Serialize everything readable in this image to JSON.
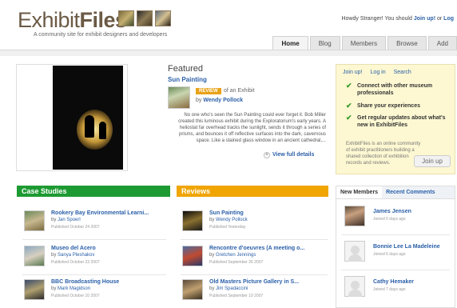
{
  "header": {
    "logo_prefix": "Exhibit",
    "logo_suffix": "Files",
    "tagline": "A community site for exhibit designers and developers",
    "howdy_text": "Howdy Stranger!  You should",
    "howdy_join": "Join up!",
    "howdy_or": "or",
    "howdy_login": "Log"
  },
  "nav": {
    "tabs": [
      "Home",
      "Blog",
      "Members",
      "Browse",
      "Add"
    ],
    "active": "Home"
  },
  "featured": {
    "heading": "Featured",
    "title": "Sun Painting",
    "badge": "REVIEW",
    "badge_suffix": "of an Exhibit",
    "by_label": "by",
    "author": "Wendy Pollock",
    "description": "No one who's seen the Sun Painting could ever forget it. Bob Miller created this luminous exhibit during the Exploratorium's early years. A heliostat far overhead tracks the sunlight, sends it through a series of prisms, and bounces it off reflective surfaces into the dark, cavernous space. Like a stained glass window in an ancient cathedral,...",
    "view_full": "View full details"
  },
  "joinbox": {
    "links": [
      "Join up!",
      "Log in",
      "Search"
    ],
    "items": [
      "Connect with other museum professionals",
      "Share your experiences",
      "Get regular updates about what's new in ExhibitFiles"
    ],
    "description": "ExhibitFiles is an online community of exhibit practitioners building a shared collection of exhibition records and reviews.",
    "button": "Join up"
  },
  "case_studies": {
    "heading": "Case Studies",
    "items": [
      {
        "title": "Rookery Bay Environmental Learni...",
        "by": "by",
        "author": "Jan Spoerl",
        "date": "Published October 24 2007"
      },
      {
        "title": "Museo del Acero",
        "by": "by",
        "author": "Sanya Pleshakov",
        "date": "Published October 23 2007"
      },
      {
        "title": "BBC Broadcasting House",
        "by": "by",
        "author": "Mark Magidson",
        "date": "Published October 10 2007"
      }
    ]
  },
  "reviews": {
    "heading": "Reviews",
    "items": [
      {
        "title": "Sun Painting",
        "by": "by",
        "author": "Wendy Pollock",
        "date": "Published Yesterday"
      },
      {
        "title": "Rencontre d'oeuvres (A meeting o...",
        "by": "by",
        "author": "Gretchen Jennings",
        "date": "Published September 26 2007"
      },
      {
        "title": "Old Masters Picture Gallery in S...",
        "by": "by",
        "author": "Jim Spadaccini",
        "date": "Published September 19 2007"
      }
    ]
  },
  "members_panel": {
    "tabs": [
      "New Members",
      "Recent Comments"
    ],
    "members": [
      {
        "name": "James Jensen",
        "joined": "Joined 5 days ago"
      },
      {
        "name": "Bonnie Lee La Madeleine",
        "joined": "Joined 6 days ago"
      },
      {
        "name": "Cathy Hemaker",
        "joined": "Joined 7 days ago"
      }
    ]
  },
  "colors": {
    "link": "#2a5fa8",
    "case_studies_green": "#1d9a32",
    "reviews_orange": "#f0a500",
    "joinbox_bg": "#fdf8d2"
  }
}
